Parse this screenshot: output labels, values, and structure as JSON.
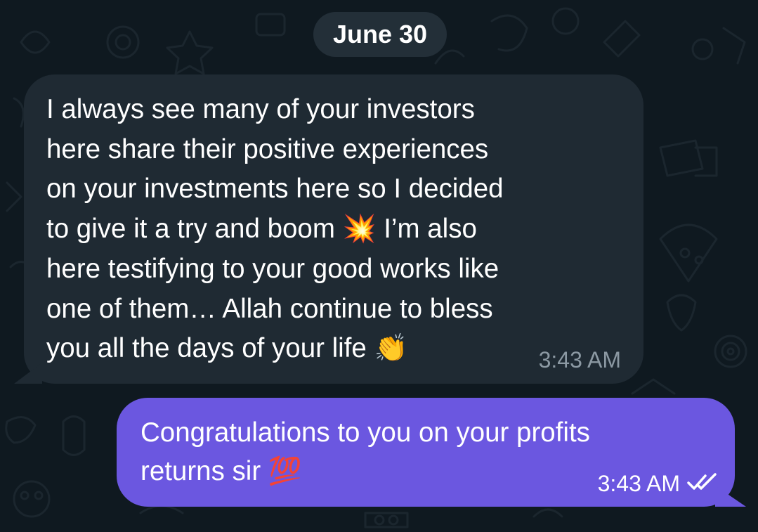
{
  "chat": {
    "date_separator": "June 30",
    "messages": [
      {
        "direction": "incoming",
        "text": "I always see many of your investors\nhere share their positive experiences\non your investments here so I decided\nto give it a try and boom 💥 I’m also\nhere testifying to your good works like\none of them… Allah continue to bless\nyou all the days of your life 👏",
        "time": "3:43 AM"
      },
      {
        "direction": "outgoing",
        "text": "Congratulations to you on your profits\nreturns sir 💯",
        "time": "3:43 AM",
        "status": "read",
        "status_icon": "double-check-icon"
      }
    ]
  },
  "theme": {
    "background": "#0f1920",
    "incoming_bubble": "#1f2a33",
    "outgoing_bubble": "#6b57e0",
    "incoming_time": "#8c99a3",
    "date_pill": "#28343e",
    "text": "#ffffff"
  }
}
